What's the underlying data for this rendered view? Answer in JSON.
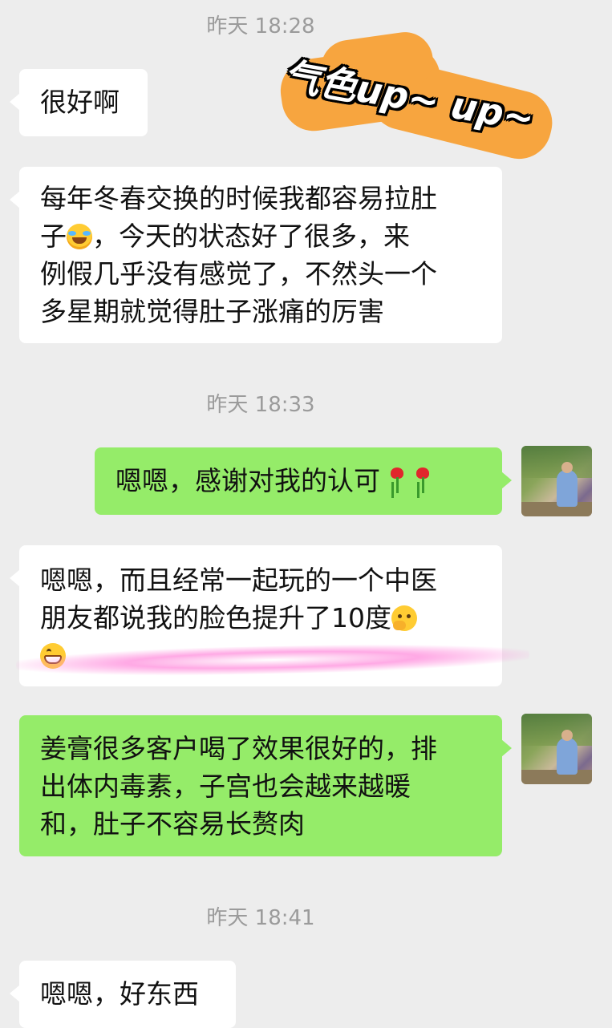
{
  "chat": {
    "timestamps": [
      "昨天 18:28",
      "昨天 18:33",
      "昨天 18:41"
    ],
    "sticker_text": "气色up~ up~",
    "messages": [
      {
        "side": "in",
        "lines": [
          "很好啊"
        ]
      },
      {
        "side": "in",
        "lines": [
          "每年冬春交换的时候我都容易拉肚",
          "，今天的状态好了很多，来",
          "例假几乎没有感觉了，不然头一个",
          "多星期就觉得肚子涨痛的厉害"
        ],
        "line2_prefix": "子"
      },
      {
        "side": "out",
        "lines": [
          "嗯嗯，感谢对我的认可"
        ]
      },
      {
        "side": "in",
        "lines": [
          "嗯嗯，而且经常一起玩的一个中医",
          "朋友都说我的脸色提升了10度"
        ]
      },
      {
        "side": "out",
        "lines": [
          "姜膏很多客户喝了效果很好的，排",
          "出体内毒素，子宫也会越来越暖",
          "和，肚子不容易长赘肉"
        ]
      },
      {
        "side": "in",
        "lines": [
          "嗯嗯，好东西"
        ]
      }
    ]
  },
  "icons": {
    "laugh": "face-with-tears-of-joy-icon",
    "rose": "rose-icon",
    "think": "thinking-face-icon",
    "grin": "grinning-face-icon"
  },
  "colors": {
    "background": "#ededed",
    "incoming_bubble": "#ffffff",
    "outgoing_bubble": "#95ec69",
    "timestamp": "#9b9b9b",
    "sticker": "#f7a53f",
    "highlight": "#ff8cdc"
  }
}
